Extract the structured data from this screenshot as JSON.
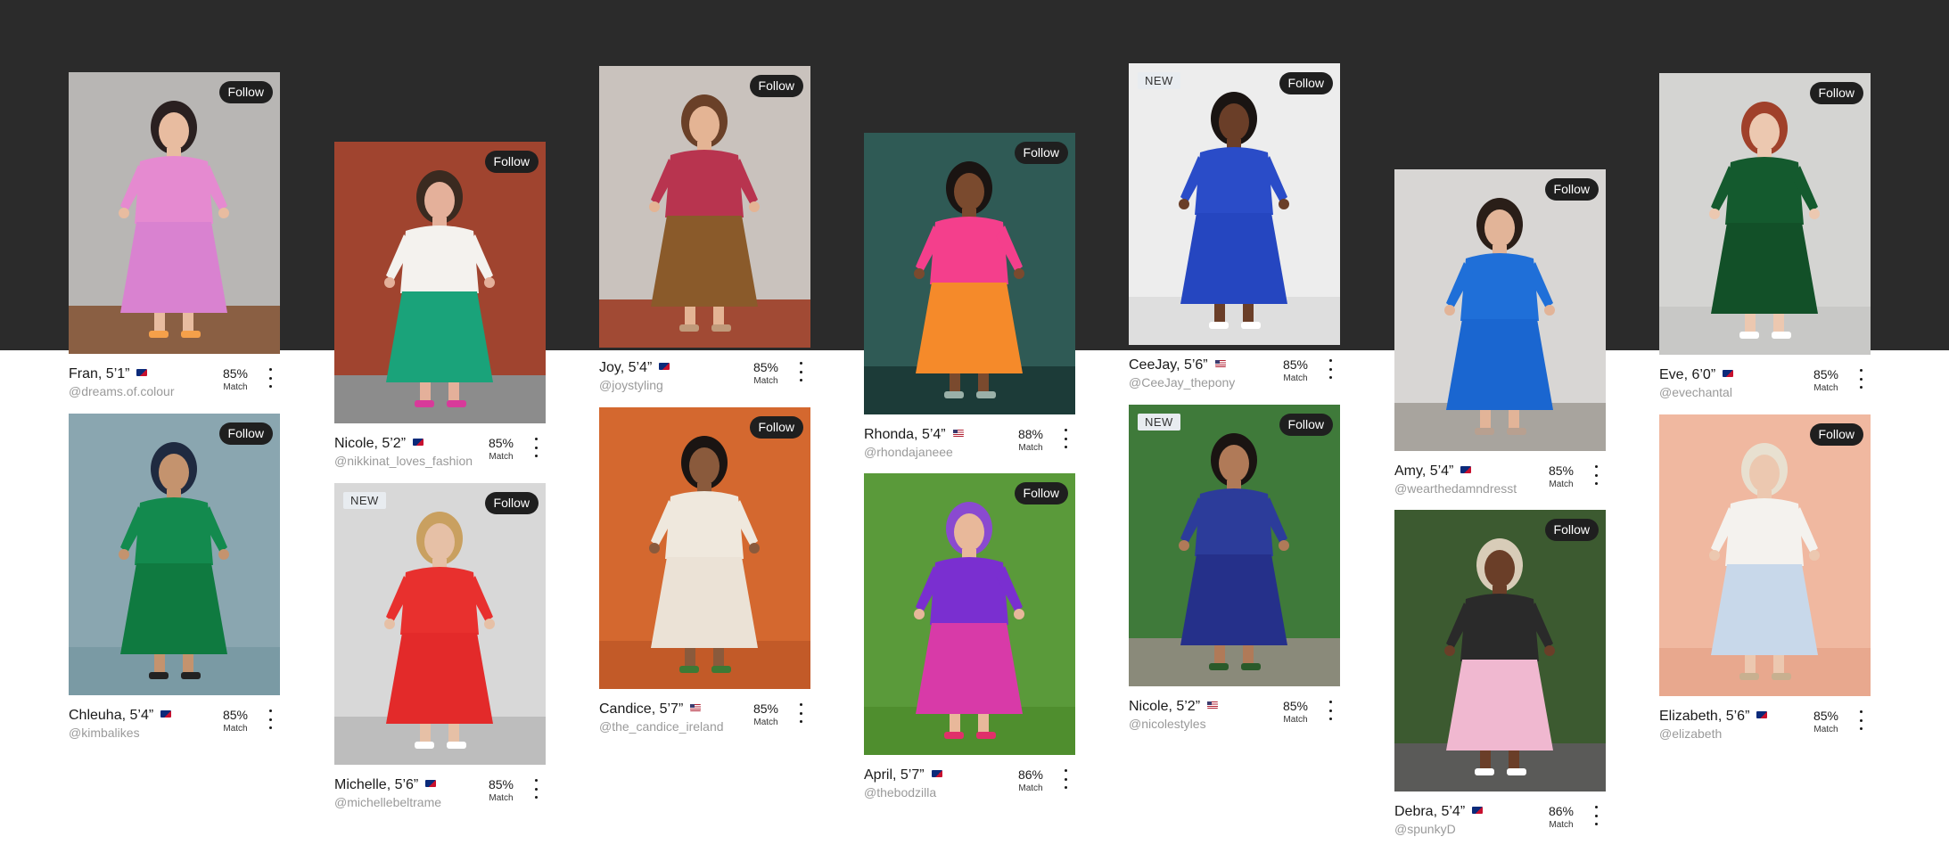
{
  "follow_label": "Follow",
  "new_label": "NEW",
  "match_label": "Match",
  "cards": [
    {
      "name": "Fran, 5’1”",
      "flag": "au",
      "handle": "@dreams.of.colour",
      "match": "85%",
      "new": false,
      "colors": {
        "bg": "#b8b6b4",
        "floor": "#8a5f43",
        "top": "#e58ad0",
        "bottom": "#d982d0",
        "skin": "#e8bca0",
        "hair": "#2a2020",
        "accent": "#f5a04a"
      }
    },
    {
      "name": "Chleuha, 5’4”",
      "flag": "au",
      "handle": "@kimbalikes",
      "match": "85%",
      "new": false,
      "colors": {
        "bg": "#8aa6b0",
        "floor": "#7a9aa4",
        "top": "#138a4e",
        "bottom": "#0f7a40",
        "skin": "#c4936e",
        "hair": "#1f2a40",
        "accent": "#222222"
      }
    },
    {
      "name": "Nicole, 5’2”",
      "flag": "au",
      "handle": "@nikkinat_loves_fashion",
      "match": "85%",
      "new": false,
      "colors": {
        "bg": "#a0442f",
        "floor": "#8c8c8c",
        "top": "#f4f2ee",
        "bottom": "#1aa37a",
        "skin": "#e4b09a",
        "hair": "#3a2a20",
        "accent": "#d83a9a"
      }
    },
    {
      "name": "Michelle, 5’6”",
      "flag": "au",
      "handle": "@michellebeltrame",
      "match": "85%",
      "new": true,
      "colors": {
        "bg": "#d8d8d8",
        "floor": "#bdbdbd",
        "top": "#e8302e",
        "bottom": "#e32a2a",
        "skin": "#e6c0a6",
        "hair": "#c9a060",
        "accent": "#ffffff"
      }
    },
    {
      "name": "Joy, 5’4”",
      "flag": "au",
      "handle": "@joystyling",
      "match": "85%",
      "new": false,
      "colors": {
        "bg": "#c9c2bd",
        "floor": "#a14a34",
        "top": "#b8344f",
        "bottom": "#8a5a2a",
        "skin": "#e4b494",
        "hair": "#6a4028",
        "accent": "#c09a7a"
      }
    },
    {
      "name": "Candice, 5’7”",
      "flag": "us",
      "handle": "@the_candice_ireland",
      "match": "85%",
      "new": false,
      "colors": {
        "bg": "#d4682f",
        "floor": "#c25a28",
        "top": "#efe8dd",
        "bottom": "#ebe2d6",
        "skin": "#8a5a3c",
        "hair": "#1a1412",
        "accent": "#3d7a35"
      }
    },
    {
      "name": "Rhonda, 5’4”",
      "flag": "us",
      "handle": "@rhondajaneee",
      "match": "88%",
      "new": false,
      "colors": {
        "bg": "#2f5a55",
        "floor": "#1c3b38",
        "top": "#f43f8c",
        "bottom": "#f58a2a",
        "skin": "#7a4a2e",
        "hair": "#1a1412",
        "accent": "#9ab0a8"
      }
    },
    {
      "name": "April, 5’7”",
      "flag": "au",
      "handle": "@thebodzilla",
      "match": "86%",
      "new": false,
      "colors": {
        "bg": "#5a9a3a",
        "floor": "#4f8e2e",
        "top": "#7a2fd0",
        "bottom": "#d83aa8",
        "skin": "#e8b89a",
        "hair": "#8a4ad0",
        "accent": "#e0306a"
      }
    },
    {
      "name": "CeeJay, 5’6”",
      "flag": "us",
      "handle": "@CeeJay_thepony",
      "match": "85%",
      "new": true,
      "colors": {
        "bg": "#ededed",
        "floor": "#dedede",
        "top": "#2a4cc8",
        "bottom": "#2546c0",
        "skin": "#6a3e28",
        "hair": "#1a1412",
        "accent": "#ffffff"
      }
    },
    {
      "name": "Nicole, 5’2”",
      "flag": "us",
      "handle": "@nicolestyles",
      "match": "85%",
      "new": true,
      "colors": {
        "bg": "#3f7a3a",
        "floor": "#8a8a7a",
        "top": "#2c3c9a",
        "bottom": "#25308a",
        "skin": "#b07a58",
        "hair": "#1a1412",
        "accent": "#2a5a2a"
      }
    },
    {
      "name": "Amy, 5’4”",
      "flag": "au",
      "handle": "@wearthedamndresst",
      "match": "85%",
      "new": false,
      "colors": {
        "bg": "#d8d6d4",
        "floor": "#a8a49e",
        "top": "#1f6fd8",
        "bottom": "#1a66d0",
        "skin": "#e2b498",
        "hair": "#2a1e18",
        "accent": "#b8a090"
      }
    },
    {
      "name": "Debra, 5’4”",
      "flag": "au",
      "handle": "@spunkyD",
      "match": "86%",
      "new": false,
      "colors": {
        "bg": "#3c5a30",
        "floor": "#5a5a58",
        "top": "#2a2a2a",
        "bottom": "#f0b8d0",
        "skin": "#6a3e28",
        "hair": "#d8ccb8",
        "accent": "#ffffff"
      }
    },
    {
      "name": "Eve, 6’0”",
      "flag": "au",
      "handle": "@evechantal",
      "match": "85%",
      "new": false,
      "colors": {
        "bg": "#d4d4d2",
        "floor": "#c8c8c6",
        "top": "#145a2e",
        "bottom": "#125028",
        "skin": "#ecc8b0",
        "hair": "#a0402a",
        "accent": "#ffffff"
      }
    },
    {
      "name": "Elizabeth, 5’6”",
      "flag": "au",
      "handle": "@elizabeth",
      "match": "85%",
      "new": false,
      "colors": {
        "bg": "#f0b8a0",
        "floor": "#e8a88e",
        "top": "#f4f2ee",
        "bottom": "#c8d8ea",
        "skin": "#ecc8b0",
        "hair": "#e8e0d0",
        "accent": "#c8b090"
      }
    }
  ]
}
